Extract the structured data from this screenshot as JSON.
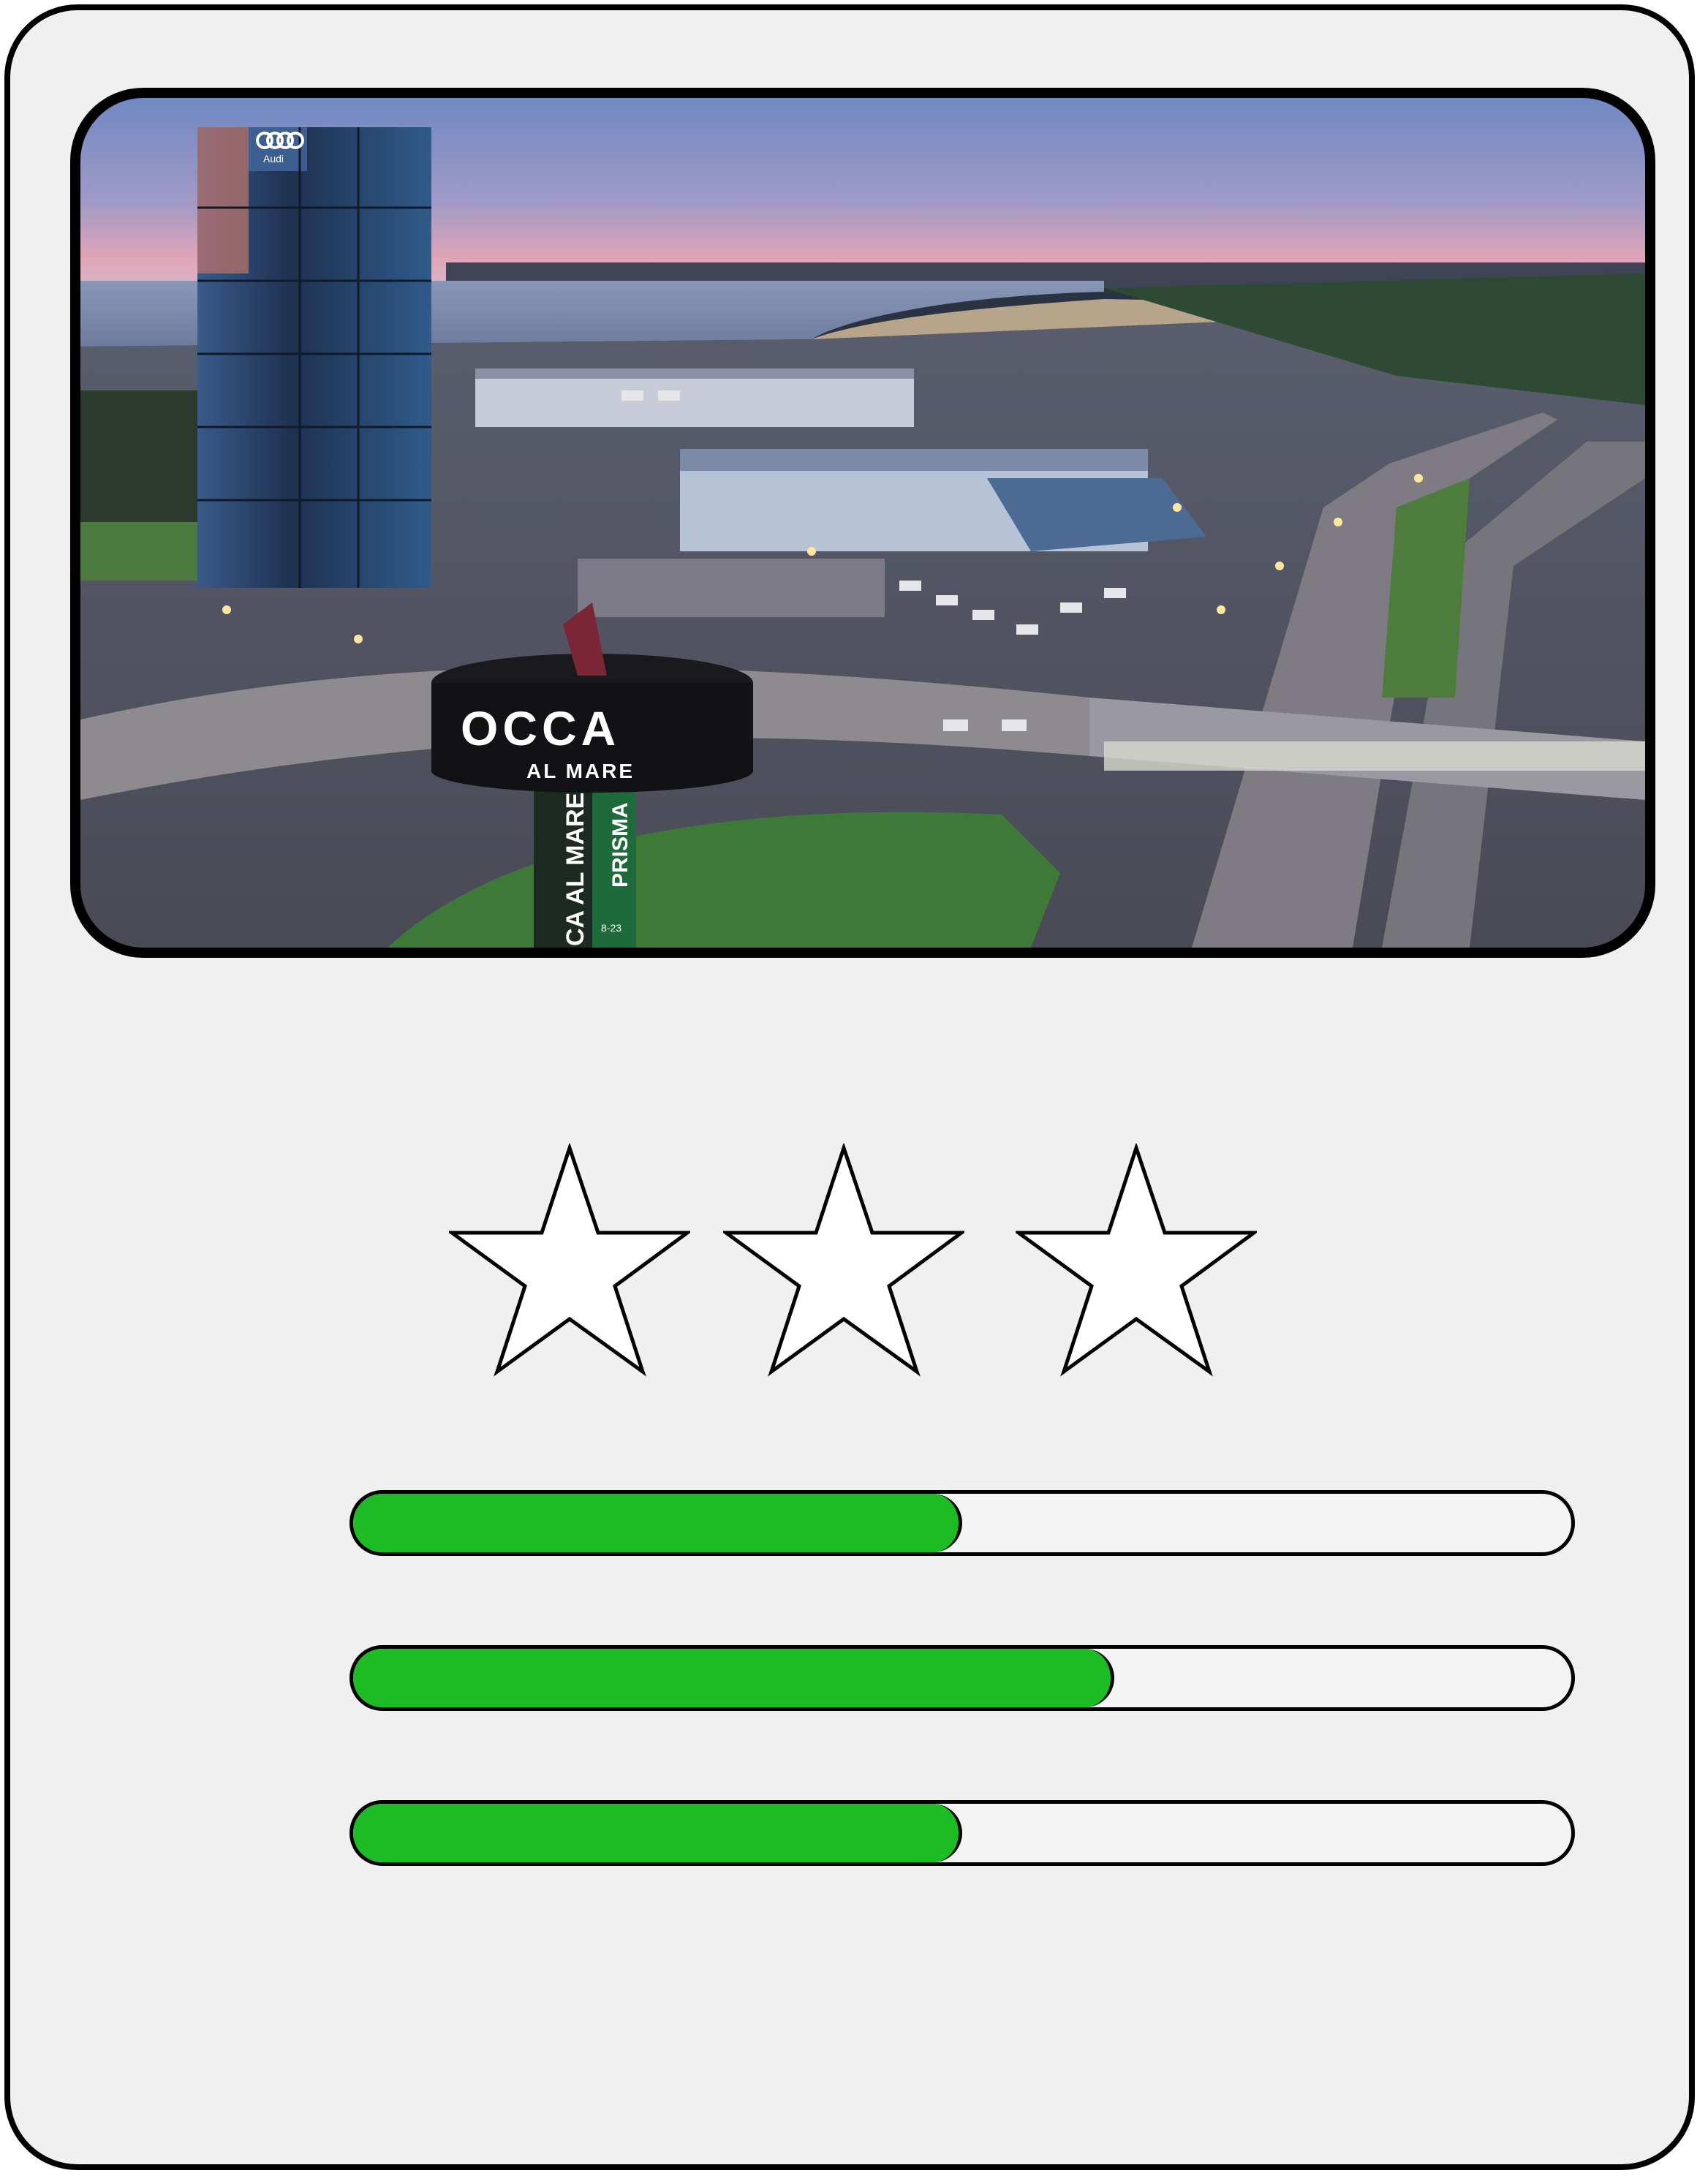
{
  "photo": {
    "icon": "city-aerial-photo",
    "sign_text_1": "OCCA",
    "sign_text_2": "AL MARE",
    "pillar_text_1": "PRISMA",
    "pillar_text_2": "CA AL MARE",
    "pillar_text_3": "PRISMA",
    "hours_text": "8-23",
    "brand_text": "Audi"
  },
  "rating": {
    "stars_total": 3,
    "icon": "star-outline-icon"
  },
  "progress_bars": [
    {
      "fraction": 0.5
    },
    {
      "fraction": 0.625
    },
    {
      "fraction": 0.5
    }
  ],
  "colors": {
    "bar_fill": "#1dbb24",
    "card_background": "#f0f0f0",
    "outline": "#000000"
  }
}
